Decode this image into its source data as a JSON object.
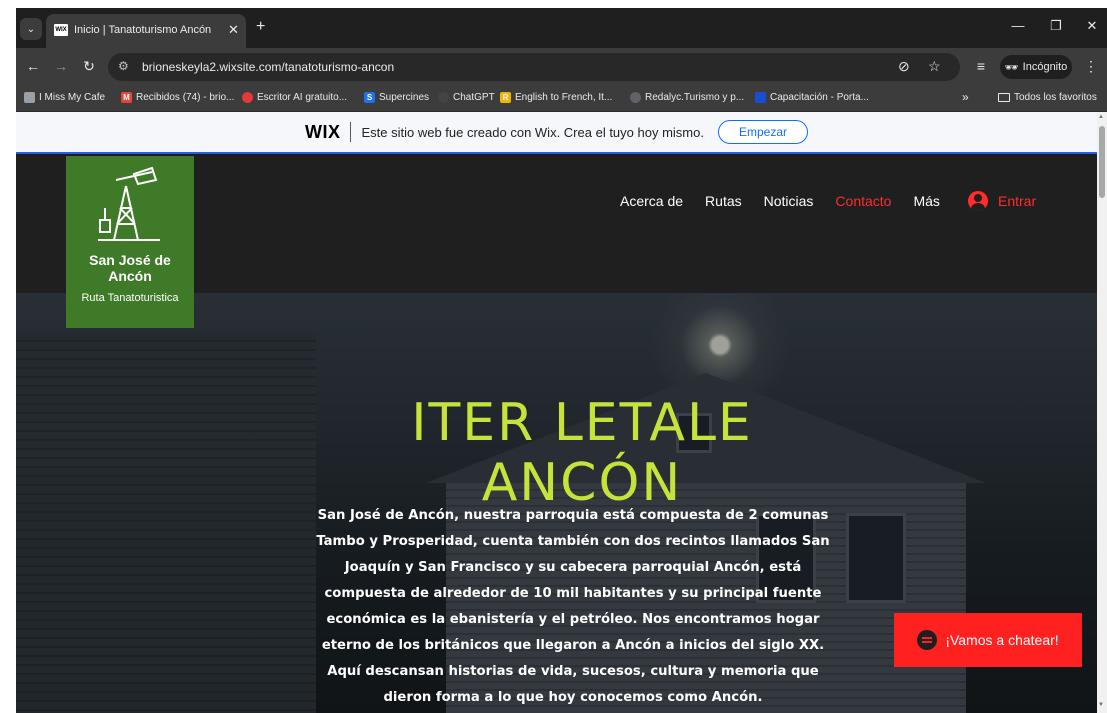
{
  "browser": {
    "tab_title": "Inicio | Tanatoturismo Ancón",
    "tab_favicon_text": "WIX",
    "url": "brioneskeyla2.wixsite.com/tanatoturismo-ancon",
    "incognito_label": "Incógnito",
    "bookmarks": [
      {
        "label": "I Miss My Cafe",
        "icon_color": "#9aa0a6"
      },
      {
        "label": "Recibidos (74) - brio...",
        "icon_color": "#ea4335"
      },
      {
        "label": "Escritor AI gratuito...",
        "icon_color": "#e53935"
      },
      {
        "label": "Supercines",
        "icon_color": "#1a73e8"
      },
      {
        "label": "ChatGPT",
        "icon_color": "#444444"
      },
      {
        "label": "English to French, It...",
        "icon_color": "#f4b400"
      },
      {
        "label": "Redalyc.Turismo y p...",
        "icon_color": "#5f6368"
      },
      {
        "label": "Capacitación - Porta...",
        "icon_color": "#1a4dd6"
      }
    ],
    "overflow_label": "»",
    "all_bookmarks_label": "Todos los favoritos"
  },
  "wix_banner": {
    "logo": "WIX",
    "text": "Este sitio web fue creado con Wix. Crea el tuyo hoy mismo.",
    "button": "Empezar"
  },
  "site": {
    "logo_name_line1": "San José de",
    "logo_name_line2": "Ancón",
    "logo_subtitle": "Ruta Tanatoturistica",
    "nav": [
      {
        "label": "Acerca de",
        "active": false
      },
      {
        "label": "Rutas",
        "active": false
      },
      {
        "label": "Noticias",
        "active": false
      },
      {
        "label": "Contacto",
        "active": true
      },
      {
        "label": "Más",
        "active": false
      }
    ],
    "login_label": "Entrar",
    "accent_color": "#ff2c2c",
    "logo_bg": "#3f7a29"
  },
  "hero": {
    "title": "ITER LETALE ANCÓN",
    "title_color": "#c6e33c",
    "paragraph": "San José de Ancón, nuestra parroquia está compuesta de 2 comunas Tambo y Prosperidad, cuenta también con dos recintos llamados San Joaquín y San Francisco y su cabecera parroquial Ancón, está compuesta de alrededor de 10 mil habitantes y su principal fuente económica es la ebanistería y el petróleo. Nos encontramos hogar eterno de los británicos que llegaron a Ancón a inicios del siglo XX. Aquí descansan historias de vida, sucesos, cultura y memoria que dieron forma a lo que hoy conocemos como Ancón."
  },
  "chat": {
    "label": "¡Vamos a chatear!"
  }
}
